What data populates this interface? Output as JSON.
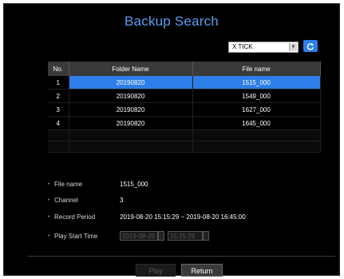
{
  "dialog": {
    "title": "Backup Search"
  },
  "device": {
    "selected": "X TICK"
  },
  "table": {
    "headers": {
      "no": "No.",
      "folder": "Folder Name",
      "file": "File name"
    },
    "rows": [
      {
        "no": "1",
        "folder": "20190820",
        "file": "1515_000"
      },
      {
        "no": "2",
        "folder": "20190820",
        "file": "1549_000"
      },
      {
        "no": "3",
        "folder": "20190820",
        "file": "1627_000"
      },
      {
        "no": "4",
        "folder": "20190820",
        "file": "1645_000"
      }
    ]
  },
  "info": {
    "file_name": {
      "label": "File name",
      "value": "1515_000"
    },
    "channel": {
      "label": "Channel",
      "value": "3"
    },
    "record_period": {
      "label": "Record Period",
      "value": "2019-08-20 15:15:29 ~ 2019-08-20 16:45:00"
    },
    "play_start": {
      "label": "Play Start Time",
      "date": "2019-08-20",
      "time": "15:15:29"
    }
  },
  "buttons": {
    "play": "Play",
    "return": "Return"
  },
  "colors": {
    "accent": "#2d7ee8",
    "title": "#5a9ef0"
  },
  "icons": {
    "refresh": "refresh-icon",
    "dropdown": "chevron-down-icon"
  }
}
